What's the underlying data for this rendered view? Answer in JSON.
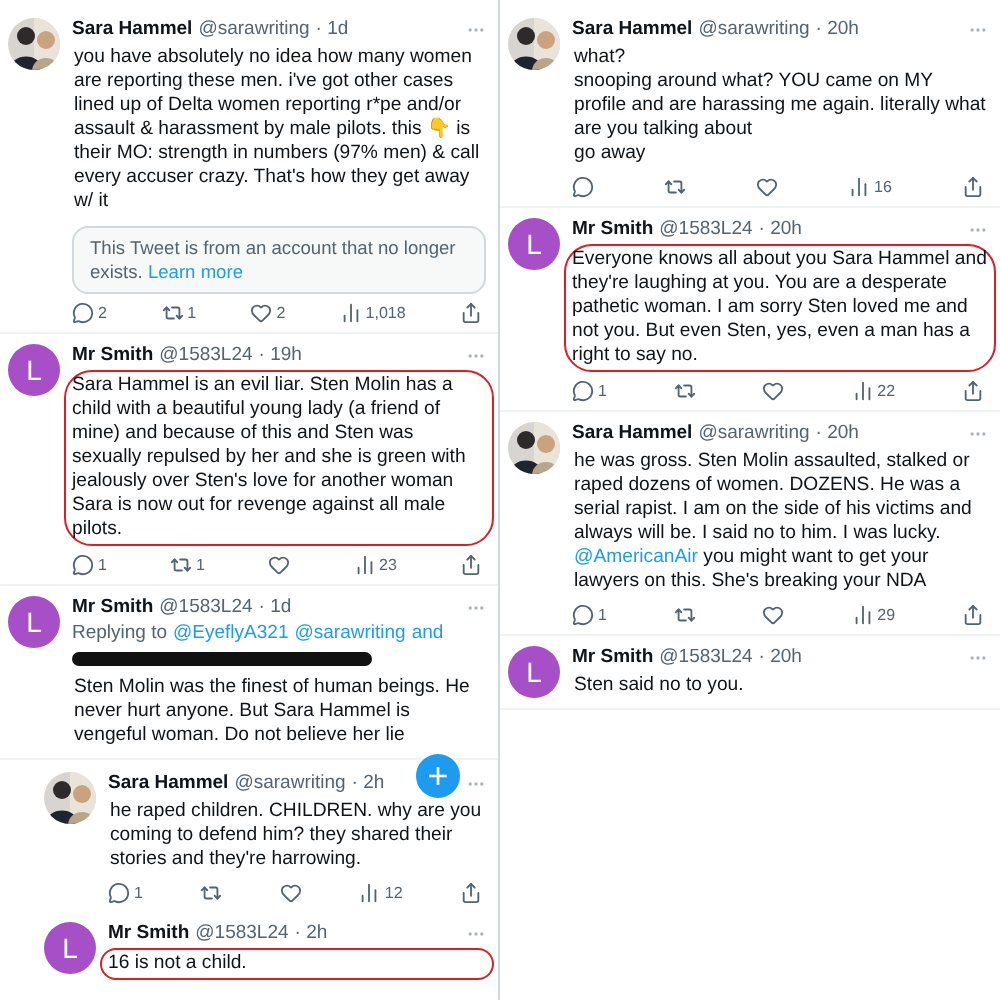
{
  "columns": [
    {
      "tweets": [
        {
          "kind": "photo",
          "name": "Sara Hammel",
          "handle": "@sarawriting",
          "time": "· 1d",
          "nested": false,
          "annotated": false,
          "body": [
            {
              "kind": "text",
              "text": "you have absolutely no idea how many women are reporting these men. i've got other cases lined up of Delta women reporting r*pe and/or assault & harassment by male pilots. this 👇 is their MO: strength in numbers (97% men) & call every accuser crazy. That's how they get away w/ it"
            }
          ],
          "quote": {
            "text": "This Tweet is from an account that no longer exists.",
            "link": "Learn more"
          },
          "actions": {
            "replies": "2",
            "retweets": "1",
            "likes": "2",
            "views": "1,018"
          }
        },
        {
          "kind": "letter",
          "letter": "L",
          "name": "Mr Smith",
          "handle": "@1583L24",
          "time": "· 19h",
          "nested": false,
          "annotated": true,
          "body": [
            {
              "kind": "text",
              "text": "Sara Hammel is an evil liar. Sten Molin has a child with a beautiful young lady (a friend of mine) and because of this and Sten was sexually repulsed by her and she is green with jealously over Sten's love for another woman Sara is now out for revenge against all male pilots."
            }
          ],
          "actions": {
            "replies": "1",
            "retweets": "1",
            "views": "23"
          }
        },
        {
          "kind": "letter",
          "letter": "L",
          "name": "Mr Smith",
          "handle": "@1583L24",
          "time": "· 1d",
          "nested": false,
          "annotated": false,
          "replying": {
            "label": "Replying to",
            "links": [
              "@EyeflyA321",
              "@sarawriting",
              "and"
            ]
          },
          "redacted": true,
          "body": [
            {
              "kind": "text",
              "text": "Sten Molin was the finest of human beings. He never hurt anyone. But Sara Hammel is vengeful woman. Do not believe her lie"
            }
          ]
        },
        {
          "kind": "photo",
          "name": "Sara Hammel",
          "handle": "@sarawriting",
          "time": "· 2h",
          "nested": true,
          "annotated": false,
          "body": [
            {
              "kind": "text",
              "text": "he raped children. CHILDREN. why are you coming to defend him? they shared their stories and they're harrowing."
            }
          ],
          "actions": {
            "replies": "1",
            "views": "12"
          }
        },
        {
          "kind": "letter",
          "letter": "L",
          "name": "Mr Smith",
          "handle": "@1583L24",
          "time": "· 2h",
          "nested": true,
          "annotated": true,
          "body": [
            {
              "kind": "text",
              "text": "16 is not a child."
            }
          ]
        }
      ]
    },
    {
      "tweets": [
        {
          "kind": "photo",
          "name": "Sara Hammel",
          "handle": "@sarawriting",
          "time": "· 20h",
          "nested": false,
          "annotated": false,
          "body": [
            {
              "kind": "text",
              "text": "what?\nsnooping around what? YOU came on MY profile and are harassing me again. literally what are you talking about\ngo away"
            }
          ],
          "actions": {
            "views": "16"
          }
        },
        {
          "kind": "letter",
          "letter": "L",
          "name": "Mr Smith",
          "handle": "@1583L24",
          "time": "· 20h",
          "nested": false,
          "annotated": true,
          "body": [
            {
              "kind": "text",
              "text": "Everyone knows all about you Sara Hammel and they're laughing at you. You are a desperate pathetic woman. I am sorry Sten loved me and not you. But even Sten, yes, even a man has a right to say no."
            }
          ],
          "actions": {
            "replies": "1",
            "views": "22"
          }
        },
        {
          "kind": "photo",
          "name": "Sara Hammel",
          "handle": "@sarawriting",
          "time": "· 20h",
          "nested": false,
          "annotated": false,
          "body": [
            {
              "kind": "text",
              "text": "he was gross. Sten Molin assaulted, stalked or raped dozens of women. DOZENS. He was a serial rapist. I am on the side of his victims and always will be. I said no to him. I was lucky. "
            },
            {
              "kind": "link",
              "text": "@AmericanAir"
            },
            {
              "kind": "text",
              "text": " you might want to get your lawyers on this. She's breaking your NDA"
            }
          ],
          "actions": {
            "replies": "1",
            "views": "29"
          }
        },
        {
          "kind": "letter",
          "letter": "L",
          "name": "Mr Smith",
          "handle": "@1583L24",
          "time": "· 20h",
          "nested": false,
          "annotated": false,
          "body": [
            {
              "kind": "text",
              "text": "Sten said no to you."
            }
          ]
        }
      ]
    }
  ],
  "compose": {
    "symbol": "+"
  }
}
